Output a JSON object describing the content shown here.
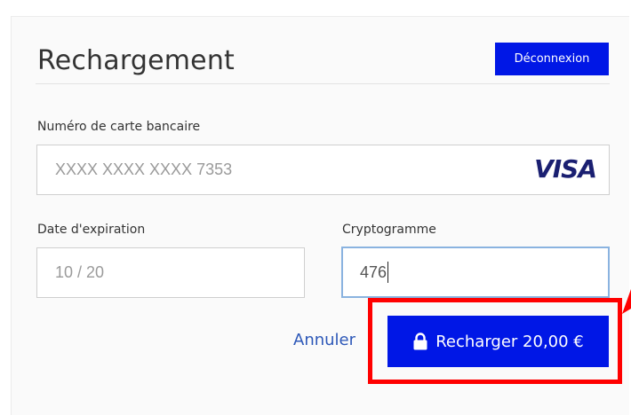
{
  "page": {
    "title": "Rechargement",
    "logout_label": "Déconnexion"
  },
  "card_number": {
    "label": "Numéro de carte bancaire",
    "value": "XXXX XXXX XXXX 7353",
    "brand": "VISA",
    "brand_icon": "visa-logo"
  },
  "expiry": {
    "label": "Date d'expiration",
    "value": "10 / 20"
  },
  "cvv": {
    "label": "Cryptogramme",
    "value": "476"
  },
  "actions": {
    "cancel_label": "Annuler",
    "recharge_label": "Recharger 20,00 €",
    "recharge_icon": "lock-icon"
  },
  "colors": {
    "primary": "#0017e6",
    "link": "#2d58b8",
    "annotation": "#ff0000",
    "focus_border": "#8ab3e0",
    "visa_blue": "#1a1f71"
  }
}
